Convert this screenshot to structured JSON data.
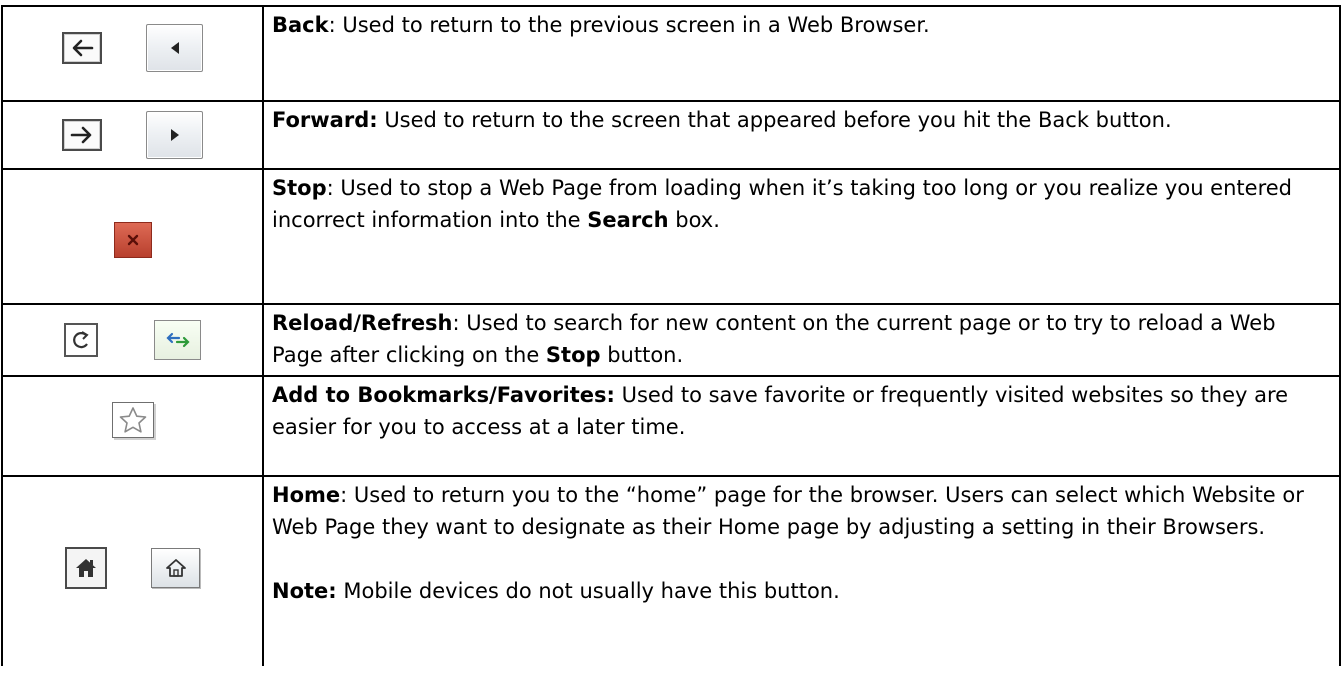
{
  "rows": [
    {
      "icons": [
        "back-arrow-icon",
        "back-triangle-icon"
      ],
      "term": "Back",
      "description": ":  Used to return to the previous screen in a Web Browser."
    },
    {
      "icons": [
        "forward-arrow-icon",
        "forward-triangle-icon"
      ],
      "term": "Forward:",
      "description": "  Used to return to the screen that appeared before you hit the Back button."
    },
    {
      "icons": [
        "stop-x-icon"
      ],
      "term": "Stop",
      "description_before": ": Used to stop a Web Page from loading when it’s taking too long or you realize you entered incorrect information into the ",
      "emphasis": "Search",
      "description_after": " box."
    },
    {
      "icons": [
        "reload-icon",
        "refresh-arrows-icon"
      ],
      "term": "Reload/Refresh",
      "description_before": ":  Used to search for new content on the current page or to try to reload a Web Page after clicking on the ",
      "emphasis": "Stop",
      "description_after": " button."
    },
    {
      "icons": [
        "star-outline-icon"
      ],
      "term": "Add to Bookmarks/Favorites:",
      "description": "  Used to save favorite or frequently visited websites so they are easier for you to access at a later time."
    },
    {
      "icons": [
        "home-dark-icon",
        "home-outline-icon"
      ],
      "term": "Home",
      "description": ": Used to return you to the “home” page for the browser.  Users can select which Website or Web Page they want to designate as their Home page by adjusting a setting in their Browsers.",
      "note_label": "Note:",
      "note_text": " Mobile devices do not usually have this button."
    }
  ],
  "colors": {
    "border": "#000000",
    "stop_red": "#c94a37",
    "refresh_green": "#2e9a3a",
    "refresh_arrow_blue": "#2f6fbf"
  }
}
